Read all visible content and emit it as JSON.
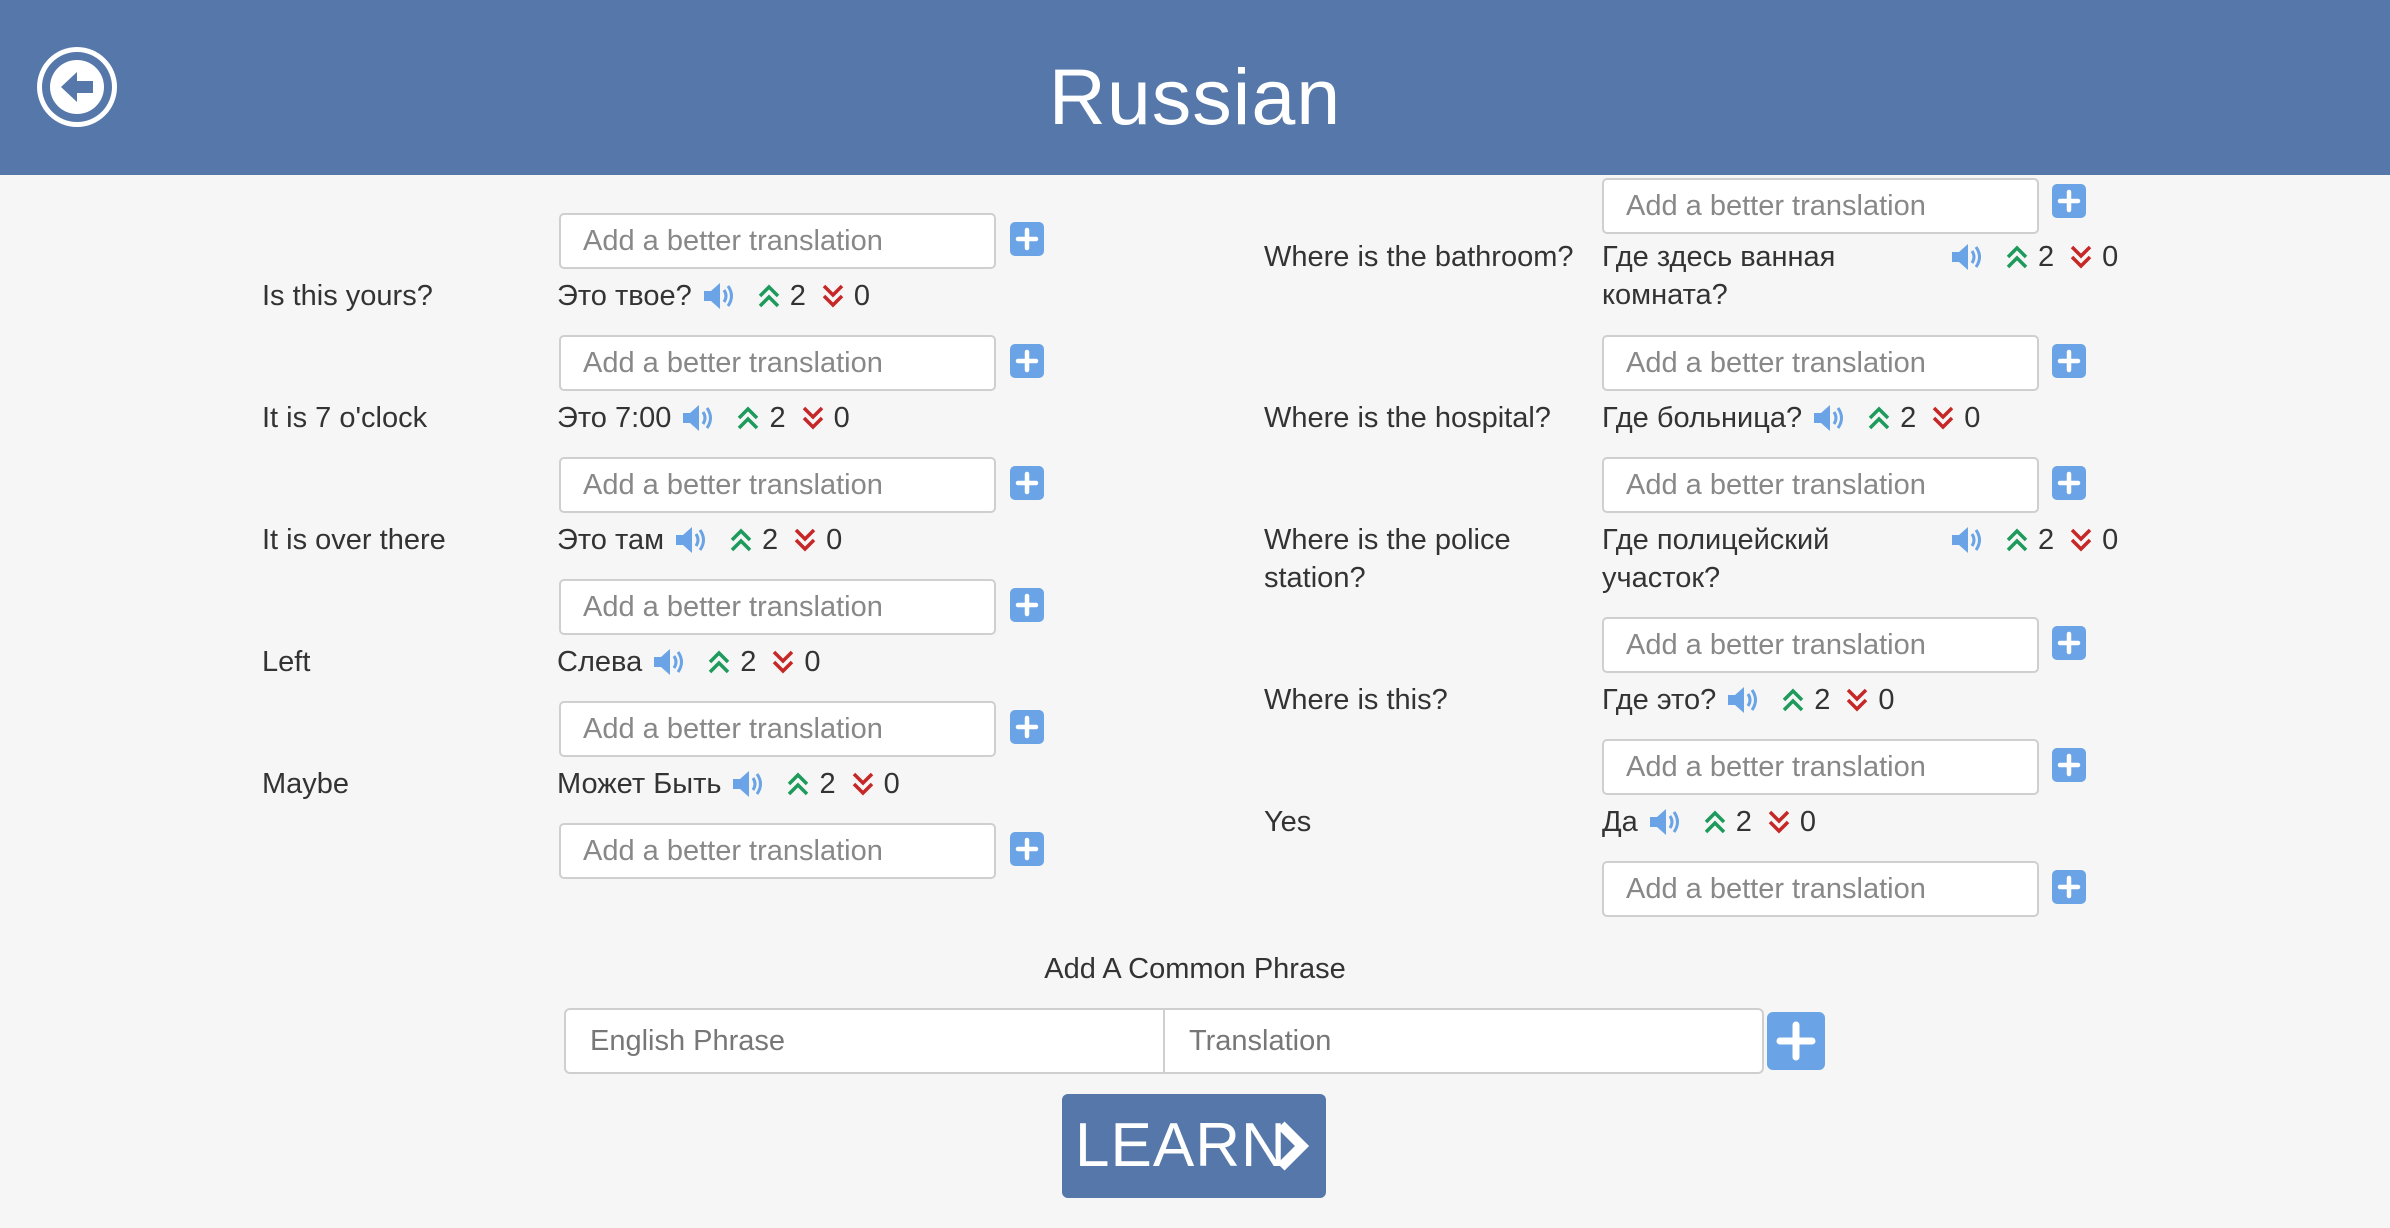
{
  "header": {
    "title": "Russian",
    "back_icon": "arrow-left-circle-icon",
    "color": "#5577a9"
  },
  "placeholders": {
    "better_translation": "Add a better translation"
  },
  "phrases_left": [
    {
      "english": "Is this yours?",
      "translation": "Это твое?",
      "up": "2",
      "down": "0"
    },
    {
      "english": "It is 7 o'clock",
      "translation": "Это 7:00",
      "up": "2",
      "down": "0"
    },
    {
      "english": "It is over there",
      "translation": "Это там",
      "up": "2",
      "down": "0"
    },
    {
      "english": "Left",
      "translation": "Слева",
      "up": "2",
      "down": "0"
    },
    {
      "english": "Maybe",
      "translation": "Может Быть",
      "up": "2",
      "down": "0"
    }
  ],
  "phrases_right": [
    {
      "english": "Where is the bathroom?",
      "translation": "Где здесь ванная комната?",
      "up": "2",
      "down": "0"
    },
    {
      "english": "Where is the hospital?",
      "translation": "Где больница?",
      "up": "2",
      "down": "0"
    },
    {
      "english": "Where is the police station?",
      "translation": "Где полицейский участок?",
      "up": "2",
      "down": "0"
    },
    {
      "english": "Where is this?",
      "translation": "Где это?",
      "up": "2",
      "down": "0"
    },
    {
      "english": "Yes",
      "translation": "Да",
      "up": "2",
      "down": "0"
    }
  ],
  "add_phrase": {
    "title": "Add A Common Phrase",
    "english_placeholder": "English Phrase",
    "translation_placeholder": "Translation"
  },
  "learn": {
    "label": "LEARN"
  },
  "colors": {
    "upvote": "#1e9a5c",
    "downvote": "#c62828",
    "accent": "#6aa3e6"
  },
  "icons": {
    "speaker": "speaker-icon",
    "upvote": "double-chevron-up-icon",
    "downvote": "double-chevron-down-icon",
    "plus": "plus-icon"
  }
}
